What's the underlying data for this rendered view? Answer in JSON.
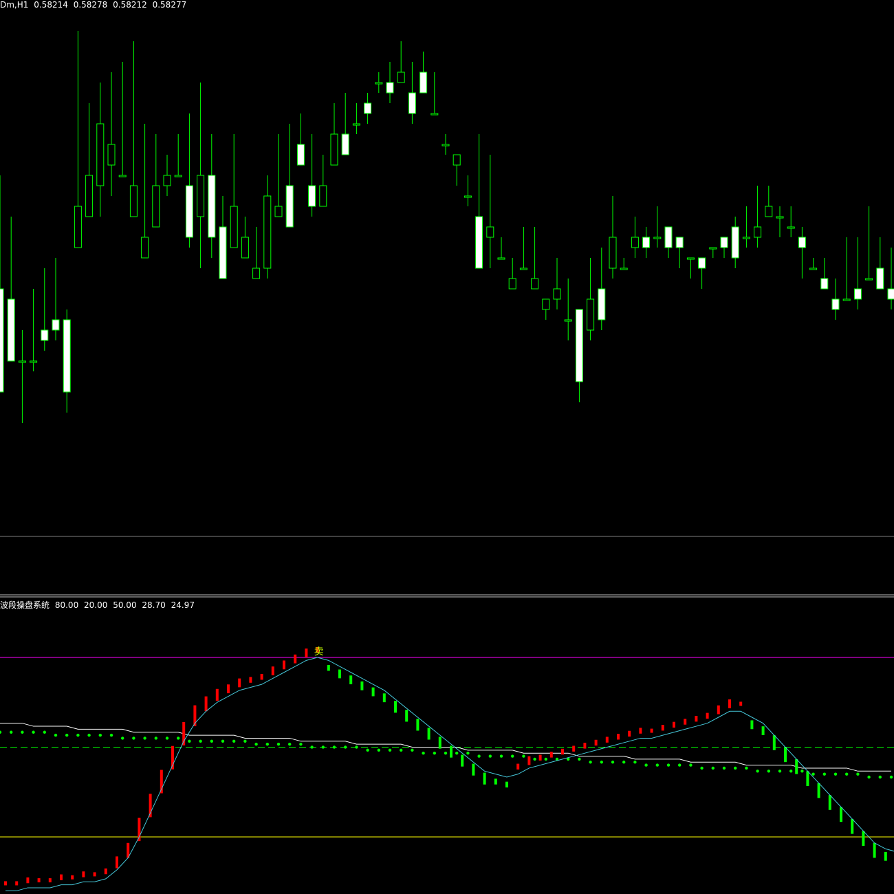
{
  "colors": {
    "background": "#000000",
    "candle_body": "#ffffff",
    "candle_wick": "#00ff00",
    "bull_bar": "#ff0000",
    "bear_bar": "#00ff00",
    "signal_line": "#45c6d8",
    "slow_line": "#ffffff",
    "dot_line": "#00ff00",
    "level_upper": "#ff00ff",
    "level_mid": "#00ff00",
    "level_lower": "#ffff00",
    "separator": "#808080",
    "signal_mark": "#c8ff00"
  },
  "main_panel": {
    "symbol_label": "Dm,H1",
    "ohlc": [
      "0.58214",
      "0.58278",
      "0.58212",
      "0.58277"
    ]
  },
  "indicator_panel": {
    "name": "波段操盘系统",
    "values": [
      "80.00",
      "20.00",
      "50.00",
      "28.70",
      "24.97"
    ],
    "signal_mark": "卖"
  },
  "chart_data": [
    {
      "type": "candlestick",
      "title": "Dm,H1",
      "close_last": "0.58277",
      "candles": [
        [
          68,
          58,
          79,
          62
        ],
        [
          67,
          61,
          75,
          61
        ],
        [
          61,
          61,
          64,
          55
        ],
        [
          61,
          61,
          68,
          60
        ],
        [
          64,
          63,
          70,
          62
        ],
        [
          65,
          64,
          71,
          63
        ],
        [
          65,
          58,
          66,
          56
        ],
        [
          72,
          76,
          93,
          74
        ],
        [
          75,
          79,
          86,
          77
        ],
        [
          78,
          84,
          88,
          75
        ],
        [
          80,
          82,
          89,
          77
        ],
        [
          79,
          79,
          90,
          80
        ],
        [
          75,
          78,
          92,
          76
        ],
        [
          71,
          73,
          84,
          73
        ],
        [
          74,
          78,
          83,
          77
        ],
        [
          78,
          79,
          81,
          77
        ],
        [
          79,
          79,
          83,
          79
        ],
        [
          78,
          73,
          85,
          72
        ],
        [
          75,
          79,
          88,
          70
        ],
        [
          79,
          73,
          83,
          71
        ],
        [
          74,
          69,
          77,
          71
        ],
        [
          72,
          76,
          83,
          74
        ],
        [
          71,
          73,
          75,
          73
        ],
        [
          69,
          70,
          74,
          70
        ],
        [
          70,
          77,
          79,
          69
        ],
        [
          75,
          76,
          83,
          75
        ],
        [
          78,
          74,
          84,
          76
        ],
        [
          82,
          80,
          85,
          81
        ],
        [
          78,
          76,
          83,
          75
        ],
        [
          76,
          78,
          81,
          76
        ],
        [
          80,
          83,
          86,
          82
        ],
        [
          83,
          81,
          87,
          82
        ],
        [
          84,
          84,
          86,
          83
        ],
        [
          86,
          85,
          87,
          84
        ],
        [
          88,
          88,
          89,
          87
        ],
        [
          88,
          87,
          90,
          86
        ],
        [
          88,
          89,
          92,
          88
        ],
        [
          87,
          85,
          90,
          84
        ],
        [
          89,
          87,
          91,
          89
        ],
        [
          85,
          85,
          89,
          85
        ],
        [
          82,
          82,
          83,
          81
        ],
        [
          80,
          81,
          81,
          78
        ],
        [
          77,
          77,
          79,
          76
        ],
        [
          75,
          70,
          83,
          71
        ],
        [
          73,
          74,
          81,
          70
        ],
        [
          71,
          71,
          73,
          72
        ],
        [
          68,
          69,
          71,
          69
        ],
        [
          70,
          70,
          74,
          70
        ],
        [
          68,
          69,
          74,
          69
        ],
        [
          66,
          67,
          67,
          65
        ],
        [
          67,
          68,
          71,
          66
        ],
        [
          65,
          65,
          69,
          63
        ],
        [
          66,
          59,
          65,
          57
        ],
        [
          64,
          67,
          71,
          63
        ],
        [
          68,
          65,
          72,
          64
        ],
        [
          70,
          73,
          77,
          69
        ],
        [
          70,
          70,
          71,
          70
        ],
        [
          72,
          73,
          75,
          71
        ],
        [
          73,
          72,
          74,
          71
        ],
        [
          73,
          73,
          76,
          72
        ],
        [
          74,
          72,
          74,
          71
        ],
        [
          73,
          72,
          73,
          70
        ],
        [
          71,
          71,
          71,
          69
        ],
        [
          71,
          70,
          71,
          68
        ],
        [
          72,
          72,
          72,
          71
        ],
        [
          73,
          72,
          73,
          71
        ],
        [
          74,
          71,
          75,
          70
        ],
        [
          73,
          73,
          76,
          72
        ],
        [
          73,
          74,
          78,
          72
        ],
        [
          75,
          76,
          78,
          75
        ],
        [
          75,
          75,
          76,
          73
        ],
        [
          74,
          74,
          76,
          73
        ],
        [
          73,
          72,
          74,
          69
        ],
        [
          70,
          70,
          71,
          70
        ],
        [
          69,
          68,
          71,
          68
        ],
        [
          67,
          66,
          69,
          65
        ],
        [
          67,
          67,
          73,
          68
        ],
        [
          68,
          67,
          73,
          66
        ],
        [
          69,
          69,
          76,
          69
        ],
        [
          70,
          68,
          73,
          68
        ],
        [
          68,
          67,
          72,
          66
        ],
        [
          67,
          65,
          68,
          63
        ],
        [
          65,
          65,
          66,
          66
        ],
        [
          63,
          63,
          65,
          62
        ],
        [
          61,
          60,
          62,
          60
        ],
        [
          60,
          59,
          61,
          58
        ],
        [
          60,
          60,
          62,
          59
        ],
        [
          59,
          59,
          61,
          60
        ],
        [
          58,
          57,
          58,
          57
        ],
        [
          57,
          58,
          58,
          56
        ],
        [
          57,
          57,
          58,
          56
        ],
        [
          56,
          56,
          56,
          55
        ],
        [
          56,
          57,
          57,
          55
        ]
      ]
    },
    {
      "type": "line",
      "title": "波段操盘系统",
      "levels": [
        80,
        50,
        20
      ],
      "ylim": [
        0,
        100
      ],
      "series": [
        {
          "name": "28.70",
          "style": "line",
          "values": [
            2,
            2,
            3,
            3,
            3,
            4,
            4,
            5,
            5,
            6,
            9,
            13,
            20,
            28,
            36,
            44,
            52,
            58,
            62,
            65,
            67,
            69,
            70,
            71,
            73,
            75,
            77,
            79,
            80,
            79,
            77,
            75,
            73,
            71,
            69,
            66,
            63,
            60,
            57,
            54,
            51,
            48,
            45,
            42,
            41,
            40,
            41,
            43,
            44,
            45,
            46,
            47,
            48,
            49,
            50,
            51,
            52,
            53,
            53,
            54,
            55,
            56,
            57,
            58,
            60,
            62,
            62,
            60,
            58,
            54,
            50,
            46,
            42,
            38,
            34,
            30,
            26,
            22,
            18,
            16,
            15
          ]
        },
        {
          "name": "24.97",
          "style": "dots",
          "values": [
            55,
            55,
            55,
            55,
            55,
            54,
            54,
            54,
            54,
            54,
            54,
            53,
            53,
            53,
            53,
            53,
            53,
            52,
            52,
            52,
            52,
            52,
            52,
            51,
            51,
            51,
            51,
            51,
            50,
            50,
            50,
            50,
            50,
            49,
            49,
            49,
            49,
            49,
            48,
            48,
            48,
            48,
            48,
            47,
            47,
            47,
            47,
            47,
            46,
            46,
            46,
            46,
            46,
            45,
            45,
            45,
            45,
            45,
            44,
            44,
            44,
            44,
            44,
            43,
            43,
            43,
            43,
            43,
            42,
            42,
            42,
            42,
            42,
            41,
            41,
            41,
            41,
            41,
            40,
            40,
            40
          ]
        },
        {
          "name": "slow",
          "style": "line",
          "values": [
            58,
            58,
            58,
            57,
            57,
            57,
            57,
            56,
            56,
            56,
            56,
            56,
            55,
            55,
            55,
            55,
            55,
            54,
            54,
            54,
            54,
            54,
            53,
            53,
            53,
            53,
            53,
            52,
            52,
            52,
            52,
            52,
            51,
            51,
            51,
            51,
            51,
            50,
            50,
            50,
            50,
            50,
            49,
            49,
            49,
            49,
            49,
            48,
            48,
            48,
            48,
            48,
            47,
            47,
            47,
            47,
            47,
            46,
            46,
            46,
            46,
            46,
            45,
            45,
            45,
            45,
            45,
            44,
            44,
            44,
            44,
            44,
            43,
            43,
            43,
            43,
            43,
            42,
            42,
            42,
            42
          ]
        }
      ]
    }
  ]
}
